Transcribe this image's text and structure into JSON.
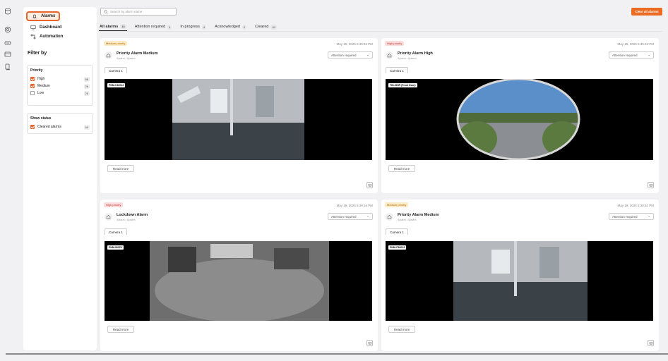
{
  "rail": {
    "icons": [
      "database-icon",
      "target-icon",
      "storage-icon",
      "card-icon",
      "device-icon"
    ]
  },
  "sidebar": {
    "nav": [
      {
        "label": "Alarms",
        "icon": "bell-icon"
      },
      {
        "label": "Dashboard",
        "icon": "monitor-icon"
      },
      {
        "label": "Automation",
        "icon": "automation-icon"
      }
    ],
    "filter_title": "Filter by",
    "priority": {
      "title": "Priority",
      "items": [
        {
          "label": "High",
          "count": "88",
          "checked": true
        },
        {
          "label": "Medium",
          "count": "26",
          "checked": true
        },
        {
          "label": "Low",
          "count": "25",
          "checked": false
        }
      ]
    },
    "status": {
      "title": "Show status",
      "items": [
        {
          "label": "Cleared alarms",
          "count": "40",
          "checked": true
        }
      ]
    }
  },
  "search": {
    "placeholder": "Search by alarm name"
  },
  "clear_all_label": "Clear all alarms",
  "tabs": [
    {
      "label": "All alarms",
      "count": "16"
    },
    {
      "label": "Attention required",
      "count": "4"
    },
    {
      "label": "In progress",
      "count": "4"
    },
    {
      "label": "Acknowledged",
      "count": "2"
    },
    {
      "label": "Cleared",
      "count": "40"
    }
  ],
  "cards": [
    {
      "priority": "Medium priority",
      "time": "May 19, 2026 5:39:46 PM",
      "title": "Priority Alarm Medium",
      "subtitle": "System • System",
      "status": "Attention required",
      "camera_tab": "Camera 1",
      "camera_label": "PNM-C16013",
      "read_more": "Read more"
    },
    {
      "priority": "High priority",
      "time": "May 19, 2026 5:39:45 PM",
      "title": "Priority Alarm High",
      "subtitle": "System • System",
      "status": "Attention required",
      "camera_tab": "Camera 1",
      "camera_label": "TID-600R (Front Door)",
      "read_more": "Read more"
    },
    {
      "priority": "High priority",
      "time": "May 19, 2026 5:39:16 PM",
      "title": "Lockdown Alarm",
      "subtitle": "System • System",
      "status": "Attention required",
      "camera_tab": "Camera 1",
      "camera_label": "PNM-9022V",
      "read_more": "Read more"
    },
    {
      "priority": "Medium priority",
      "time": "May 19, 2026 5:30:52 PM",
      "title": "Priority Alarm Medium",
      "subtitle": "System • System",
      "status": "Attention required",
      "camera_tab": "Camera 1",
      "camera_label": "PNM-C16013",
      "read_more": "Read more"
    }
  ],
  "colors": {
    "accent": "#ec6b22",
    "highlight_border": "#e8642d"
  }
}
